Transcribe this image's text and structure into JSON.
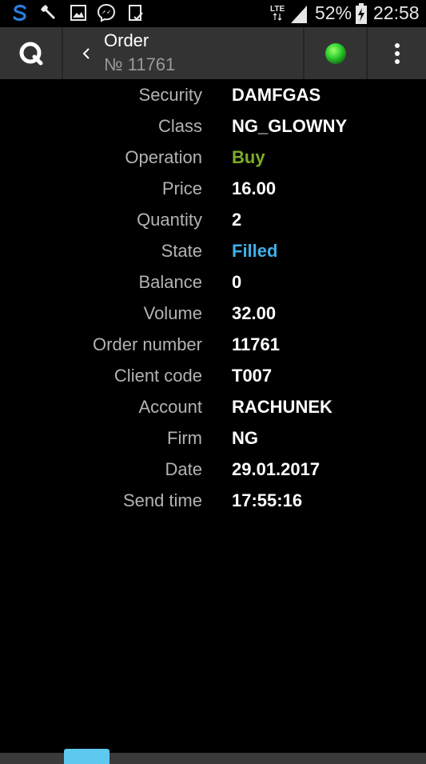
{
  "status_bar": {
    "network_type": "LTE",
    "battery_percent": "52%",
    "time": "22:58",
    "left_icons": [
      "s-app-icon",
      "wrench-icon",
      "image-icon",
      "messenger-icon",
      "clipboard-check-icon"
    ]
  },
  "action_bar": {
    "title": "Order",
    "subtitle": "№ 11761",
    "connection_status_color": "#2fd12f"
  },
  "order": {
    "fields": [
      {
        "label": "Security",
        "value": "DAMFGAS",
        "color": "#ffffff"
      },
      {
        "label": "Class",
        "value": "NG_GLOWNY",
        "color": "#ffffff"
      },
      {
        "label": "Operation",
        "value": "Buy",
        "color": "#7cad28"
      },
      {
        "label": "Price",
        "value": "16.00",
        "color": "#ffffff"
      },
      {
        "label": "Quantity",
        "value": "2",
        "color": "#ffffff"
      },
      {
        "label": "State",
        "value": "Filled",
        "color": "#3fb0e8"
      },
      {
        "label": "Balance",
        "value": "0",
        "color": "#ffffff"
      },
      {
        "label": "Volume",
        "value": "32.00",
        "color": "#ffffff"
      },
      {
        "label": "Order number",
        "value": "11761",
        "color": "#ffffff"
      },
      {
        "label": "Client code",
        "value": "T007",
        "color": "#ffffff"
      },
      {
        "label": "Account",
        "value": "RACHUNEK",
        "color": "#ffffff"
      },
      {
        "label": "Firm",
        "value": "NG",
        "color": "#ffffff"
      },
      {
        "label": "Date",
        "value": "29.01.2017",
        "color": "#ffffff"
      },
      {
        "label": "Send time",
        "value": "17:55:16",
        "color": "#ffffff"
      }
    ]
  },
  "colors": {
    "accent": "#5ec8ee",
    "buy": "#7cad28",
    "filled": "#3fb0e8"
  }
}
